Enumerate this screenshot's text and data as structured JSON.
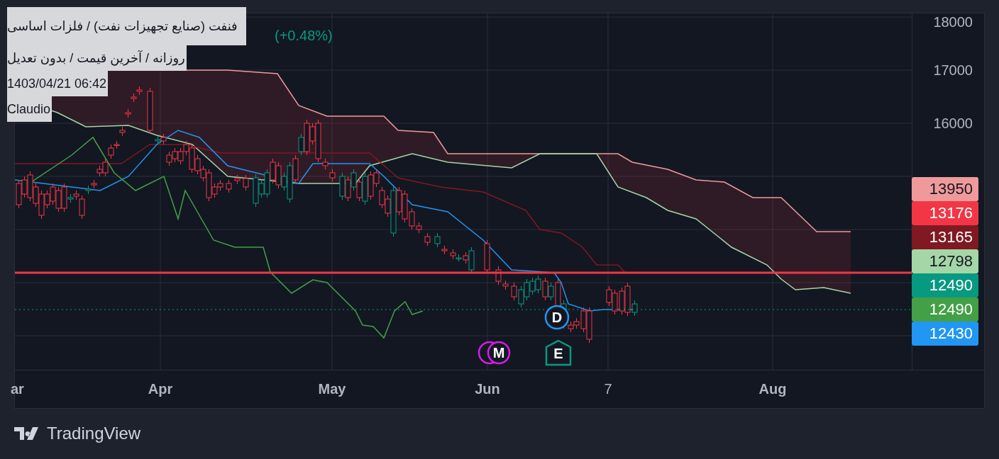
{
  "legend": {
    "change": "(+0.48%)"
  },
  "info_lines": [
    "فنفت (صنایع تجهیزات نفت) / فلزات اساسی",
    "روزانه / آخرین قیمت / بدون تعدیل",
    "1403/04/21 06:42",
    "Claudio"
  ],
  "price_axis": {
    "ticks": [
      "18000",
      "17000",
      "16000"
    ]
  },
  "price_tags": [
    {
      "value": "13950",
      "color": "#ef9a9a"
    },
    {
      "value": "13176",
      "color": "#f23645"
    },
    {
      "value": "13165",
      "color": "#801922"
    },
    {
      "value": "12798",
      "color": "#a5d6a7"
    },
    {
      "value": "12490",
      "color": "#089981"
    },
    {
      "value": "12490",
      "color": "#43a047"
    },
    {
      "value": "12430",
      "color": "#2196f3"
    }
  ],
  "time_axis": {
    "labels": [
      {
        "text": "ar",
        "kind": "month"
      },
      {
        "text": "Apr",
        "kind": "month"
      },
      {
        "text": "May",
        "kind": "month"
      },
      {
        "text": "Jun",
        "kind": "month"
      },
      {
        "text": "7",
        "kind": "day"
      },
      {
        "text": "Aug",
        "kind": "month"
      }
    ]
  },
  "markers": [
    {
      "label": "M",
      "kind": "double-circle",
      "color": "#d41ee4"
    },
    {
      "label": "D",
      "kind": "circle",
      "color": "#2196f3"
    },
    {
      "label": "E",
      "kind": "house",
      "color": "#089981"
    }
  ],
  "footer": {
    "brand": "TradingView"
  }
}
